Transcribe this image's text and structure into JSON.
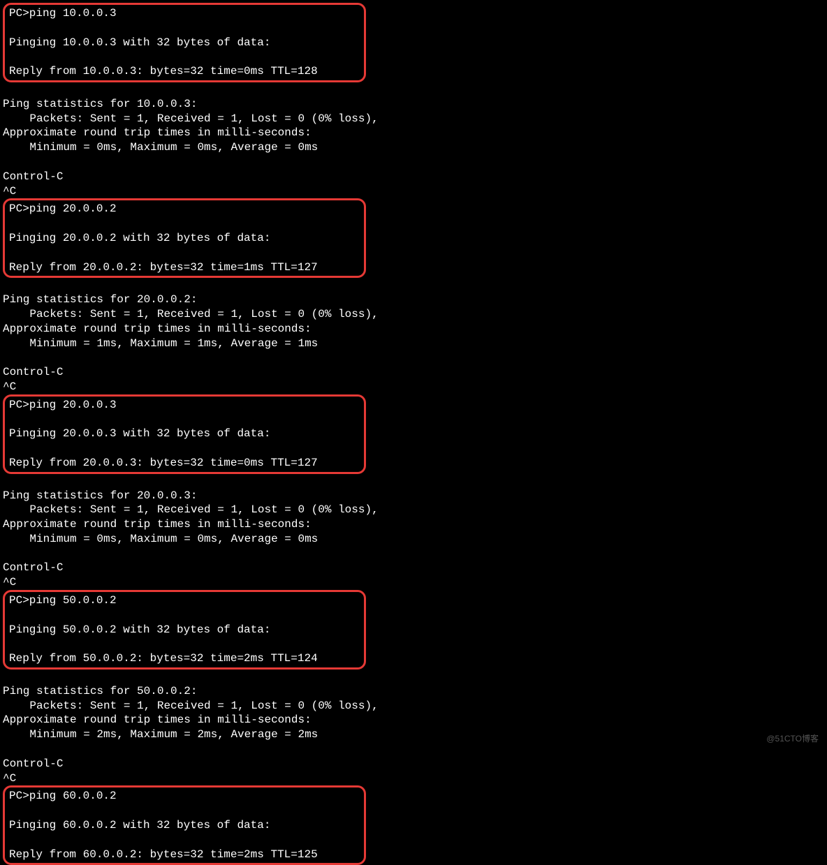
{
  "sections": [
    {
      "highlighted": true,
      "lines": [
        "PC>ping 10.0.0.3",
        "",
        "Pinging 10.0.0.3 with 32 bytes of data:",
        "",
        "Reply from 10.0.0.3: bytes=32 time=0ms TTL=128"
      ]
    },
    {
      "highlighted": false,
      "lines": [
        "",
        "Ping statistics for 10.0.0.3:",
        "    Packets: Sent = 1, Received = 1, Lost = 0 (0% loss),",
        "Approximate round trip times in milli-seconds:",
        "    Minimum = 0ms, Maximum = 0ms, Average = 0ms",
        "",
        "Control-C",
        "^C"
      ]
    },
    {
      "highlighted": true,
      "lines": [
        "PC>ping 20.0.0.2",
        "",
        "Pinging 20.0.0.2 with 32 bytes of data:",
        "",
        "Reply from 20.0.0.2: bytes=32 time=1ms TTL=127"
      ]
    },
    {
      "highlighted": false,
      "lines": [
        "",
        "Ping statistics for 20.0.0.2:",
        "    Packets: Sent = 1, Received = 1, Lost = 0 (0% loss),",
        "Approximate round trip times in milli-seconds:",
        "    Minimum = 1ms, Maximum = 1ms, Average = 1ms",
        "",
        "Control-C",
        "^C"
      ]
    },
    {
      "highlighted": true,
      "lines": [
        "PC>ping 20.0.0.3",
        "",
        "Pinging 20.0.0.3 with 32 bytes of data:",
        "",
        "Reply from 20.0.0.3: bytes=32 time=0ms TTL=127"
      ]
    },
    {
      "highlighted": false,
      "lines": [
        "",
        "Ping statistics for 20.0.0.3:",
        "    Packets: Sent = 1, Received = 1, Lost = 0 (0% loss),",
        "Approximate round trip times in milli-seconds:",
        "    Minimum = 0ms, Maximum = 0ms, Average = 0ms",
        "",
        "Control-C",
        "^C"
      ]
    },
    {
      "highlighted": true,
      "lines": [
        "PC>ping 50.0.0.2",
        "",
        "Pinging 50.0.0.2 with 32 bytes of data:",
        "",
        "Reply from 50.0.0.2: bytes=32 time=2ms TTL=124"
      ]
    },
    {
      "highlighted": false,
      "lines": [
        "",
        "Ping statistics for 50.0.0.2:",
        "    Packets: Sent = 1, Received = 1, Lost = 0 (0% loss),",
        "Approximate round trip times in milli-seconds:",
        "    Minimum = 2ms, Maximum = 2ms, Average = 2ms",
        "",
        "Control-C",
        "^C"
      ]
    },
    {
      "highlighted": true,
      "lines": [
        "PC>ping 60.0.0.2",
        "",
        "Pinging 60.0.0.2 with 32 bytes of data:",
        "",
        "Reply from 60.0.0.2: bytes=32 time=2ms TTL=125"
      ]
    }
  ],
  "watermark": "@51CTO博客"
}
